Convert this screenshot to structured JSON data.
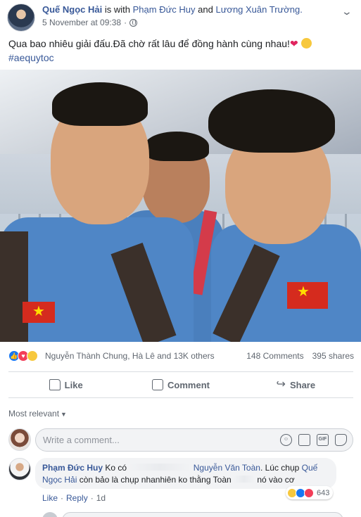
{
  "post": {
    "author": "Quế Ngọc Hải",
    "with_text": "is with",
    "tagged_1": "Phạm Đức Huy",
    "and_text": "and",
    "tagged_2": "Lương Xuân Trường.",
    "date": "5 November at 09:38",
    "separator": "·",
    "body_text": "Qua bao nhiêu giải đấu.Đã chờ rất lâu để đồng hành cùng nhau!",
    "hashtag": "#aequytoc",
    "icons": {
      "heart": "heart-icon",
      "sad": "sad-icon",
      "options": "chevron-down-icon",
      "privacy": "globe-icon"
    }
  },
  "reactions": {
    "names": "Nguyễn Thành Chung, Hà Lê and 13K others",
    "comments": "148 Comments",
    "shares": "395 shares",
    "colors": {
      "like": "#1877f2",
      "love": "#f33e58",
      "haha": "#f7c83d"
    }
  },
  "actions": {
    "like": "Like",
    "comment": "Comment",
    "share": "Share"
  },
  "sort": {
    "label": "Most relevant"
  },
  "composer": {
    "placeholder": "Write a comment...",
    "gif_label": "GIF"
  },
  "comment": {
    "author": "Phạm Đức Huy",
    "text_1": "Ko có",
    "mention_1": "Nguyễn Văn Toàn",
    "text_2": ". Lúc chụp",
    "mention_2a": "Quế",
    "mention_2b": "Ngọc Hải",
    "text_3": "còn bảo là chụp nhanh",
    "text_4": "iên ko thằng Toàn",
    "text_5": "nó vào cơ",
    "reaction_count": "643",
    "like": "Like",
    "reply": "Reply",
    "dot": "·",
    "time": "1d"
  }
}
